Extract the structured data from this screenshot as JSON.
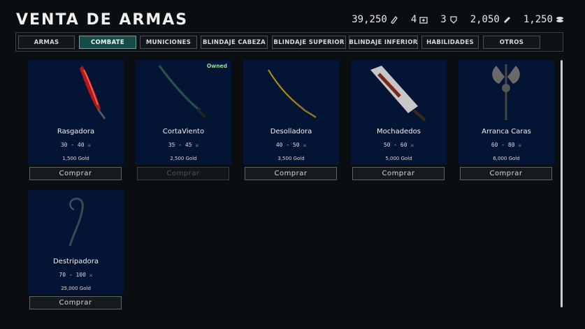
{
  "header": {
    "title": "VENTA DE ARMAS",
    "stats": [
      {
        "value": "39,250",
        "icon": "bullet-icon"
      },
      {
        "value": "4",
        "icon": "medkit-icon"
      },
      {
        "value": "3",
        "icon": "armor-icon"
      },
      {
        "value": "2,050",
        "icon": "scrap-icon"
      },
      {
        "value": "1,250",
        "icon": "coins-icon"
      }
    ]
  },
  "tabs": [
    {
      "label": "ARMAS",
      "active": false
    },
    {
      "label": "COMBATE",
      "active": true
    },
    {
      "label": "MUNICIONES",
      "active": false
    },
    {
      "label": "BLINDAJE CABEZA",
      "active": false
    },
    {
      "label": "BLINDAJE SUPERIOR",
      "active": false
    },
    {
      "label": "BLINDAJE INFERIOR",
      "active": false
    },
    {
      "label": "HABILIDADES",
      "active": false
    },
    {
      "label": "OTROS",
      "active": false
    }
  ],
  "items": [
    {
      "name": "Rasgadora",
      "damage": "30 - 40",
      "price": "1,500 Gold",
      "button": "Comprar",
      "owned": false,
      "icon": "red-blade-icon"
    },
    {
      "name": "CortaViento",
      "damage": "35 - 45",
      "price": "2,500 Gold",
      "button": "Comprar",
      "owned": true,
      "owned_label": "Owned",
      "icon": "katana-icon"
    },
    {
      "name": "Desolladora",
      "damage": "40 - 50",
      "price": "3,500 Gold",
      "button": "Comprar",
      "owned": false,
      "icon": "golden-sword-icon"
    },
    {
      "name": "Mochadedos",
      "damage": "50 - 60",
      "price": "5,000 Gold",
      "button": "Comprar",
      "owned": false,
      "icon": "cleaver-icon"
    },
    {
      "name": "Arranca Caras",
      "damage": "60 - 80",
      "price": "6,000 Gold",
      "button": "Comprar",
      "owned": false,
      "icon": "axe-icon"
    },
    {
      "name": "Destripadora",
      "damage": "70 - 100",
      "price": "25,000 Gold",
      "button": "Comprar",
      "owned": false,
      "icon": "scythe-icon"
    }
  ],
  "colors": {
    "accent": "#174b48",
    "card_bg": "#031435",
    "owned": "#8fe39a"
  }
}
